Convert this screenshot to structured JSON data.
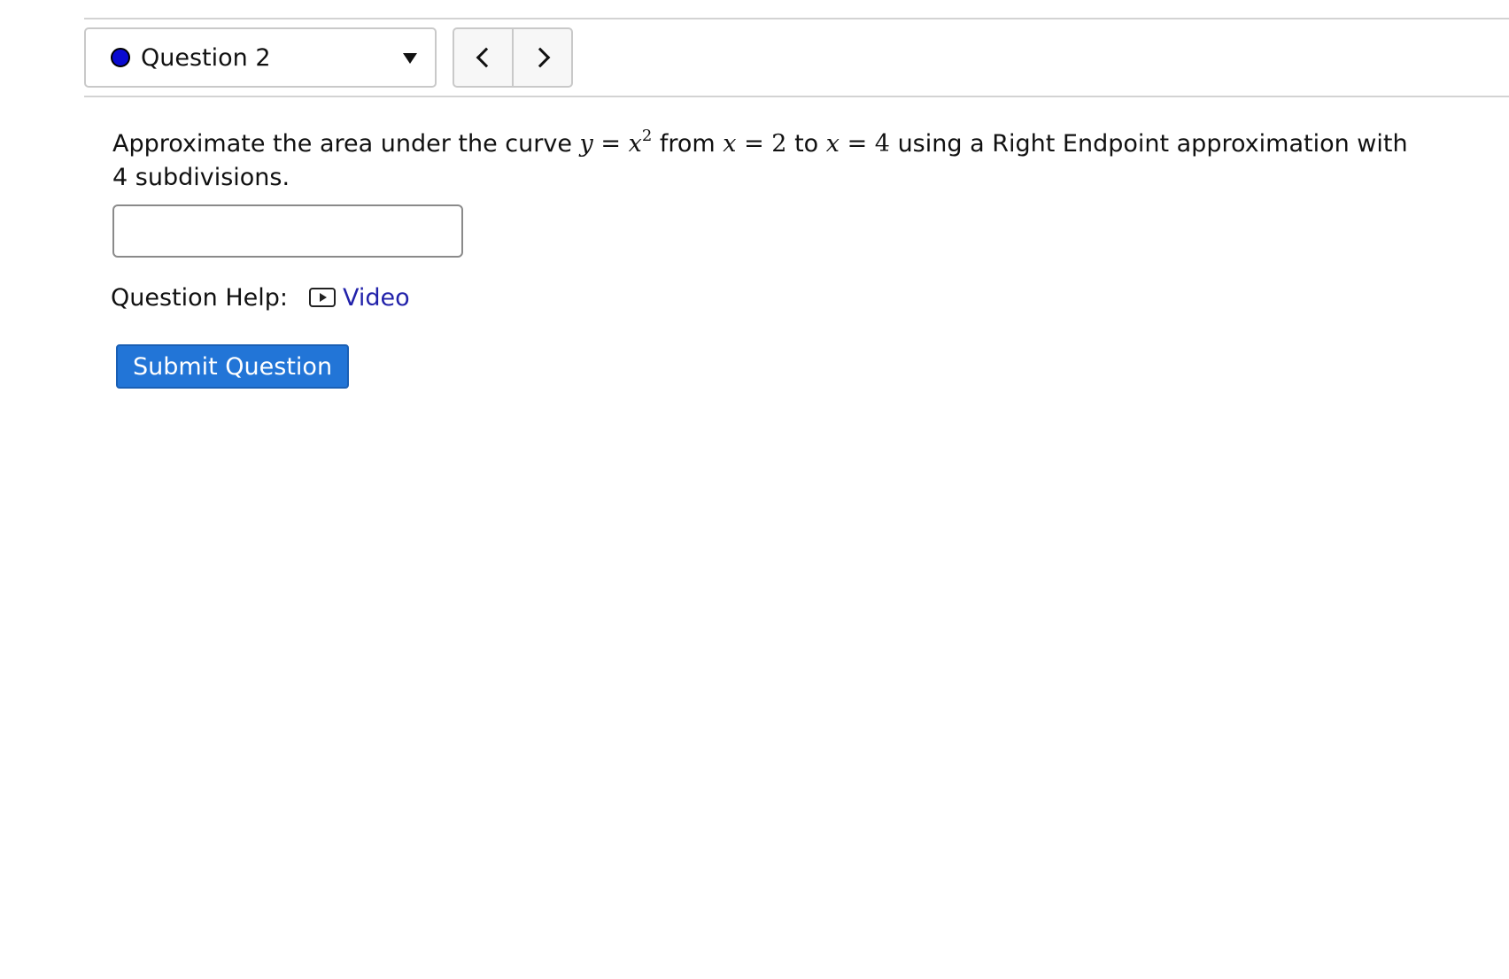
{
  "navigation": {
    "question_selector": {
      "label": "Question 2",
      "status_color": "#0a0ad0"
    },
    "prev_icon": "chevron-left-icon",
    "next_icon": "chevron-right-icon"
  },
  "question": {
    "text_1": "Approximate the area under the curve ",
    "math_y": "y",
    "math_eq1": " = ",
    "math_x": "x",
    "math_exp": "2",
    "text_2": " from ",
    "math_x2": "x",
    "math_eq2": " = ",
    "math_a": "2",
    "text_3": " to ",
    "math_x3": "x",
    "math_eq3": " = ",
    "math_b": "4",
    "text_4": " using a Right Endpoint approximation with 4 subdivisions."
  },
  "answer": {
    "value": ""
  },
  "help": {
    "label": "Question Help:",
    "video_label": "Video",
    "video_icon": "video-play-icon"
  },
  "submit": {
    "label": "Submit Question",
    "color": "#2275d7"
  }
}
